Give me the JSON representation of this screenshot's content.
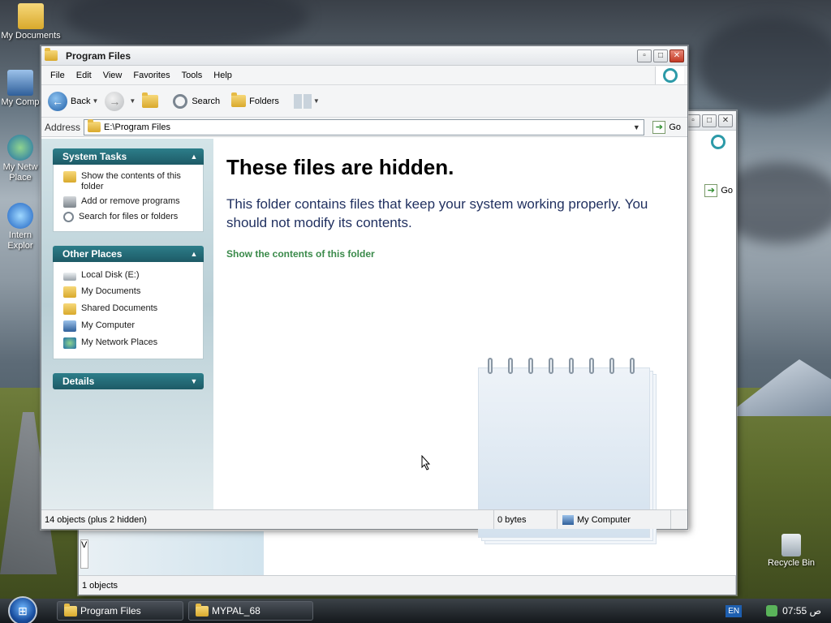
{
  "desktop": {
    "icons": [
      {
        "label": "My Documents"
      },
      {
        "label": "My Comp"
      },
      {
        "label": "My Netw"
      },
      {
        "label": "Place"
      },
      {
        "label": "Intern"
      },
      {
        "label": "Explor"
      },
      {
        "label": "Recycle Bin"
      }
    ]
  },
  "back_window": {
    "go_label": "Go",
    "status": "1 objects",
    "partial_label": "V"
  },
  "window": {
    "title": "Program Files",
    "menu": [
      "File",
      "Edit",
      "View",
      "Favorites",
      "Tools",
      "Help"
    ],
    "toolbar": {
      "back": "Back",
      "search": "Search",
      "folders": "Folders"
    },
    "address": {
      "label": "Address",
      "value": "E:\\Program Files",
      "go": "Go"
    },
    "system_tasks": {
      "title": "System Tasks",
      "items": [
        "Show the contents of this folder",
        "Add or remove programs",
        "Search for files or folders"
      ]
    },
    "other_places": {
      "title": "Other Places",
      "items": [
        "Local Disk (E:)",
        "My Documents",
        "Shared Documents",
        "My Computer",
        "My Network Places"
      ]
    },
    "details": {
      "title": "Details"
    },
    "content": {
      "title": "These files are hidden.",
      "message": "This folder contains files that keep your system working properly. You should not modify its contents.",
      "link": "Show the contents of this folder"
    },
    "status": {
      "objects": "14 objects (plus 2 hidden)",
      "size": "0 bytes",
      "location": "My Computer"
    }
  },
  "taskbar": {
    "buttons": [
      "Program Files",
      "MYPAL_68"
    ],
    "lang": "EN",
    "clock": "07:55 ص"
  }
}
